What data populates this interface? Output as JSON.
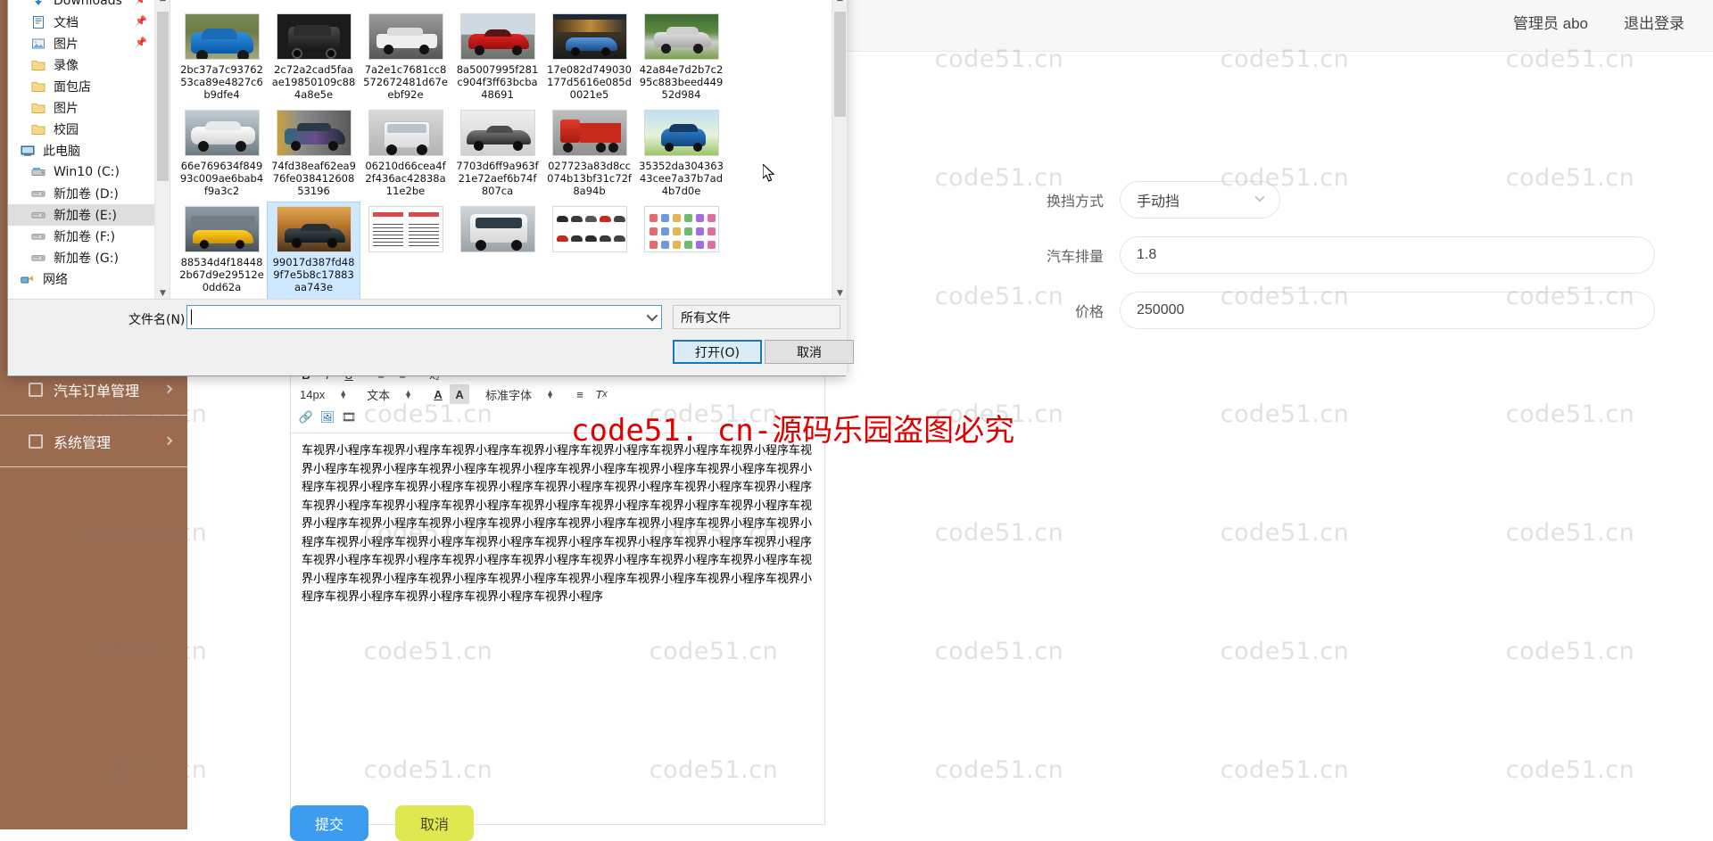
{
  "app": {
    "header": {
      "user": "管理员 abo",
      "logout": "退出登录"
    },
    "sidebar": {
      "items": [
        {
          "label": "汽车订单管理",
          "icon": "clipboard-icon"
        },
        {
          "label": "系统管理",
          "icon": "settings-icon"
        }
      ]
    },
    "form": {
      "fields": [
        {
          "label": "换挡方式",
          "value": "手动挡",
          "type": "select"
        },
        {
          "label": "汽车排量",
          "value": "1.8",
          "type": "text"
        },
        {
          "label": "价格",
          "value": "250000",
          "type": "text"
        }
      ]
    },
    "editor": {
      "toolbar": {
        "font_size": "14px",
        "format": "文本",
        "font_family": "标准字体",
        "text_color_icon": "A",
        "highlight_icon": "A",
        "align_icon": "align-icon",
        "clear_format_icon": "Tx",
        "link_icon": "link-icon",
        "image_icon": "image-icon",
        "video_icon": "video-icon"
      },
      "content": "车视界小程序车视界小程序车视界小程序车视界小程序车视界小程序车视界小程序车视界小程序车视界小程序车视界小程序车视界小程序车视界小程序车视界小程序车视界小程序车视界小程序车视界小程序车视界小程序车视界小程序车视界小程序车视界小程序车视界小程序车视界小程序车视界小程序车视界小程序车视界小程序车视界小程序车视界小程序车视界小程序车视界小程序车视界小程序车视界小程序车视界小程序车视界小程序车视界小程序车视界小程序车视界小程序车视界小程序车视界小程序车视界小程序车视界小程序车视界小程序车视界小程序车视界小程序车视界小程序车视界小程序车视界小程序车视界小程序车视界小程序车视界小程序车视界小程序车视界小程序车视界小程序车视界小程序车视界小程序车视界小程序车视界小程序车视界小程序车视界小程序车视界小程序车视界小程序车视界小程序车视界小程序车视界小程序车视界小程序"
    },
    "buttons": {
      "submit": "提交",
      "cancel": "取消"
    }
  },
  "watermark": {
    "text": "code51.cn",
    "red_text": "code51. cn-源码乐园盗图必究"
  },
  "dialog": {
    "nav": [
      {
        "label": "Downloads",
        "icon": "download-icon",
        "pinned": true,
        "indent": 1
      },
      {
        "label": "文档",
        "icon": "document-icon",
        "pinned": true,
        "indent": 1
      },
      {
        "label": "图片",
        "icon": "pictures-icon",
        "pinned": true,
        "indent": 1
      },
      {
        "label": "录像",
        "icon": "folder-icon",
        "pinned": false,
        "indent": 1
      },
      {
        "label": "面包店",
        "icon": "folder-icon",
        "pinned": false,
        "indent": 1
      },
      {
        "label": "图片",
        "icon": "folder-icon",
        "pinned": false,
        "indent": 1
      },
      {
        "label": "校园",
        "icon": "folder-icon",
        "pinned": false,
        "indent": 1
      },
      {
        "label": "此电脑",
        "icon": "computer-icon",
        "pinned": false,
        "indent": 0
      },
      {
        "label": "Win10 (C:)",
        "icon": "harddrive-icon",
        "pinned": false,
        "indent": 1
      },
      {
        "label": "新加卷 (D:)",
        "icon": "drive-icon",
        "pinned": false,
        "indent": 1
      },
      {
        "label": "新加卷 (E:)",
        "icon": "drive-icon",
        "pinned": false,
        "indent": 1,
        "selected": true
      },
      {
        "label": "新加卷 (F:)",
        "icon": "drive-icon",
        "pinned": false,
        "indent": 1
      },
      {
        "label": "新加卷 (G:)",
        "icon": "drive-icon",
        "pinned": false,
        "indent": 1
      },
      {
        "label": "网络",
        "icon": "network-icon",
        "pinned": false,
        "indent": 0
      }
    ],
    "files": [
      {
        "name": "2bc37a7c9376253ca89e4827c6b9dfe4",
        "thumb": "blue-mustang"
      },
      {
        "name": "2c72a2cad5faaae19850109c884a8e5e",
        "thumb": "black-suv"
      },
      {
        "name": "7a2e1c7681cc8572672481d67eebf92e",
        "thumb": "white-ae86"
      },
      {
        "name": "8a5007995f281c904f3ff63bcba48691",
        "thumb": "red-ferrari"
      },
      {
        "name": "17e082d749030177d5616e085d0021e5",
        "thumb": "blue-bugatti"
      },
      {
        "name": "42a84e7d2b7c295c883beed44952d984",
        "thumb": "silver-sedan"
      },
      {
        "name": "66e769634f84993c009ae6bab4f9a3c2",
        "thumb": "white-sedan"
      },
      {
        "name": "74fd38eaf62ea976fe03841260853196",
        "thumb": "tuned-coupe"
      },
      {
        "name": "06210d66cea4f2f436ac42838a11e2be",
        "thumb": "white-jeep"
      },
      {
        "name": "7703d6ff9a963f21e72aef6b74f807ca",
        "thumb": "grey-concept"
      },
      {
        "name": "027723a83d8cc074b13bf31c72f8a94b",
        "thumb": "red-truck"
      },
      {
        "name": "35352da30436343cee7a37b7ad4b7d0e",
        "thumb": "blue-sport"
      },
      {
        "name": "88534d4f184482b67d9e29512e0dd62a",
        "thumb": "yellow-mclaren"
      },
      {
        "name": "99017d387fd489f7e5b8c17883aa743e",
        "thumb": "dark-supercar",
        "selected": true
      },
      {
        "name": "",
        "thumb": "chart-row"
      },
      {
        "name": "",
        "thumb": "white-van"
      },
      {
        "name": "",
        "thumb": "car-grid"
      },
      {
        "name": "",
        "thumb": "icons-sheet"
      },
      {
        "name": "",
        "thumb": "logo-wall"
      },
      {
        "name": "",
        "thumb": "green-car"
      },
      {
        "name": "",
        "thumb": "red-car2"
      }
    ],
    "filename_label": "文件名(N):",
    "filename_value": "",
    "filter_value": "所有文件",
    "open_button": "打开(O)",
    "cancel_button": "取消"
  }
}
